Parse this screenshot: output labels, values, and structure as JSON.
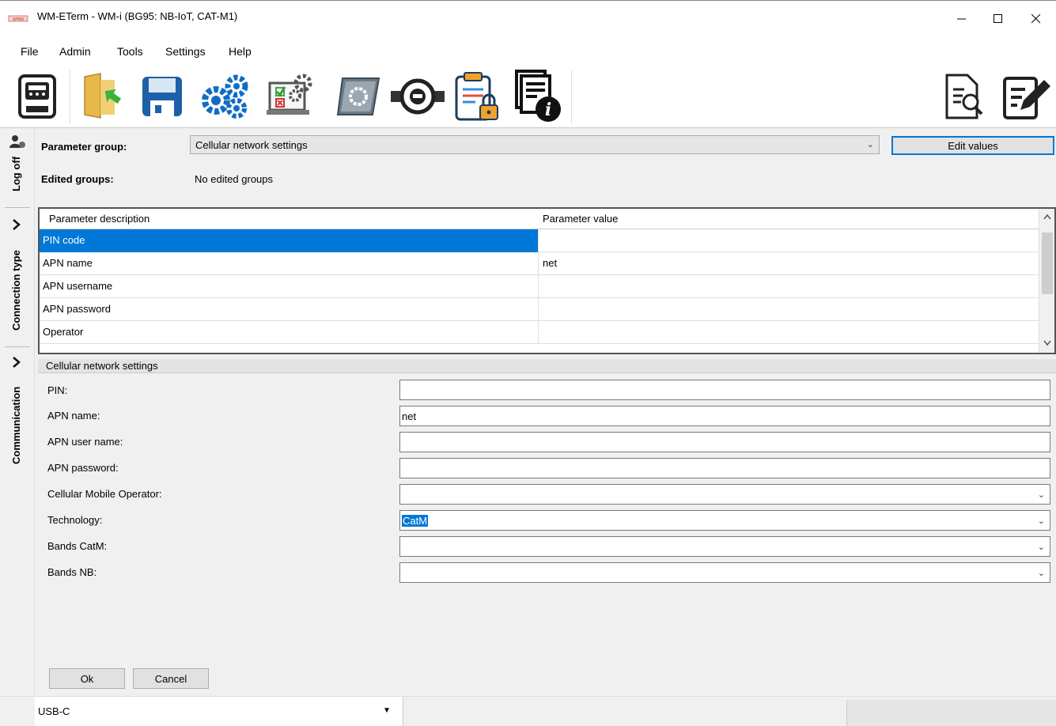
{
  "window": {
    "title": "WM-ETerm - WM-i (BG95: NB-IoT, CAT-M1)"
  },
  "menu": [
    "File",
    "Admin",
    "Tools",
    "Settings",
    "Help"
  ],
  "toolbar_icons": [
    "meter-icon",
    "folder-import-icon",
    "save-icon",
    "settings-gears-icon",
    "config-laptop-icon",
    "firmware-icon",
    "water-meter-icon",
    "clipboard-lock-icon",
    "document-info-icon",
    "report-search-icon",
    "edit-document-icon"
  ],
  "side_tabs": {
    "log_off": "Log off",
    "connection_type": "Connection type",
    "communication": "Communication"
  },
  "header": {
    "parameter_group_label": "Parameter group:",
    "parameter_group_value": "Cellular network settings",
    "edit_values_label": "Edit values",
    "edited_groups_label": "Edited groups:",
    "edited_groups_value": "No edited groups"
  },
  "grid": {
    "columns": [
      "Parameter description",
      "Parameter value"
    ],
    "rows": [
      {
        "description": "PIN code",
        "value": ""
      },
      {
        "description": "APN name",
        "value": "net"
      },
      {
        "description": "APN username",
        "value": ""
      },
      {
        "description": "APN password",
        "value": ""
      },
      {
        "description": "Operator",
        "value": ""
      }
    ]
  },
  "form": {
    "title": "Cellular network settings",
    "fields": [
      {
        "label": "PIN:",
        "value": ""
      },
      {
        "label": "APN name:",
        "value": "net"
      },
      {
        "label": "APN user name:",
        "value": ""
      },
      {
        "label": "APN password:",
        "value": ""
      },
      {
        "label": "Cellular Mobile Operator:",
        "value": ""
      },
      {
        "label": "Technology:",
        "value": "CatM"
      },
      {
        "label": "Bands CatM:",
        "value": ""
      },
      {
        "label": "Bands NB:",
        "value": ""
      }
    ],
    "ok_label": "Ok",
    "cancel_label": "Cancel"
  },
  "status": {
    "connection": "USB-C"
  }
}
